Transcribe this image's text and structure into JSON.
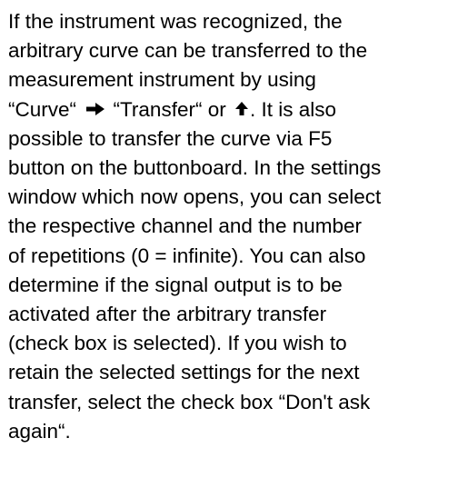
{
  "paragraph": {
    "line1": "If the instrument was recognized, the",
    "line2": "arbitrary curve can be transferred to the",
    "line3": "measurement instrument by using",
    "line4": {
      "before_arrow": "“Curve“ ",
      "between_arrow": " “Transfer“ or ",
      "after_arrow": ". It is also"
    },
    "line5": "possible to transfer the curve via F5",
    "line6": "button on the buttonboard. In the settings",
    "line7": "window which now opens, you can select",
    "line8": "the respective channel and the number",
    "line9": "of repetitions (0 = infinite). You can also",
    "line10": "determine if the signal output is to be",
    "line11": "activated after the arbitrary transfer",
    "line12": "(check box is selected). If you wish to",
    "line13": "retain the selected settings for the next",
    "line14": "transfer, select the check box “Don't ask",
    "line15": "again“."
  },
  "icons": {
    "arrow_right": "right-arrow-icon",
    "arrow_up": "up-arrow-icon"
  }
}
